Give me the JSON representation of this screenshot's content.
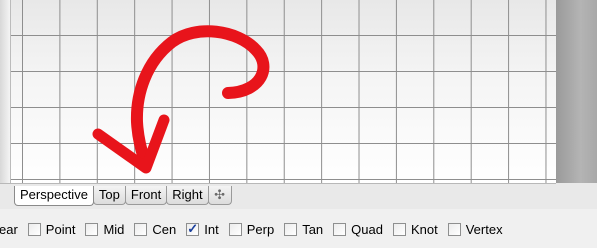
{
  "viewport": {
    "annotation": {
      "stroke_color": "#e8141b"
    }
  },
  "tabs": [
    {
      "label": "Perspective",
      "active": true
    },
    {
      "label": "Top",
      "active": false
    },
    {
      "label": "Front",
      "active": false
    },
    {
      "label": "Right",
      "active": false
    }
  ],
  "add_tab_label": "✣",
  "osnap": {
    "truncated_label": "ear",
    "items": [
      {
        "label": "Point",
        "checked": false
      },
      {
        "label": "Mid",
        "checked": false
      },
      {
        "label": "Cen",
        "checked": false
      },
      {
        "label": "Int",
        "checked": true,
        "check_glyph": "✓"
      },
      {
        "label": "Perp",
        "checked": false
      },
      {
        "label": "Tan",
        "checked": false
      },
      {
        "label": "Quad",
        "checked": false
      },
      {
        "label": "Knot",
        "checked": false
      },
      {
        "label": "Vertex",
        "checked": false
      }
    ]
  }
}
